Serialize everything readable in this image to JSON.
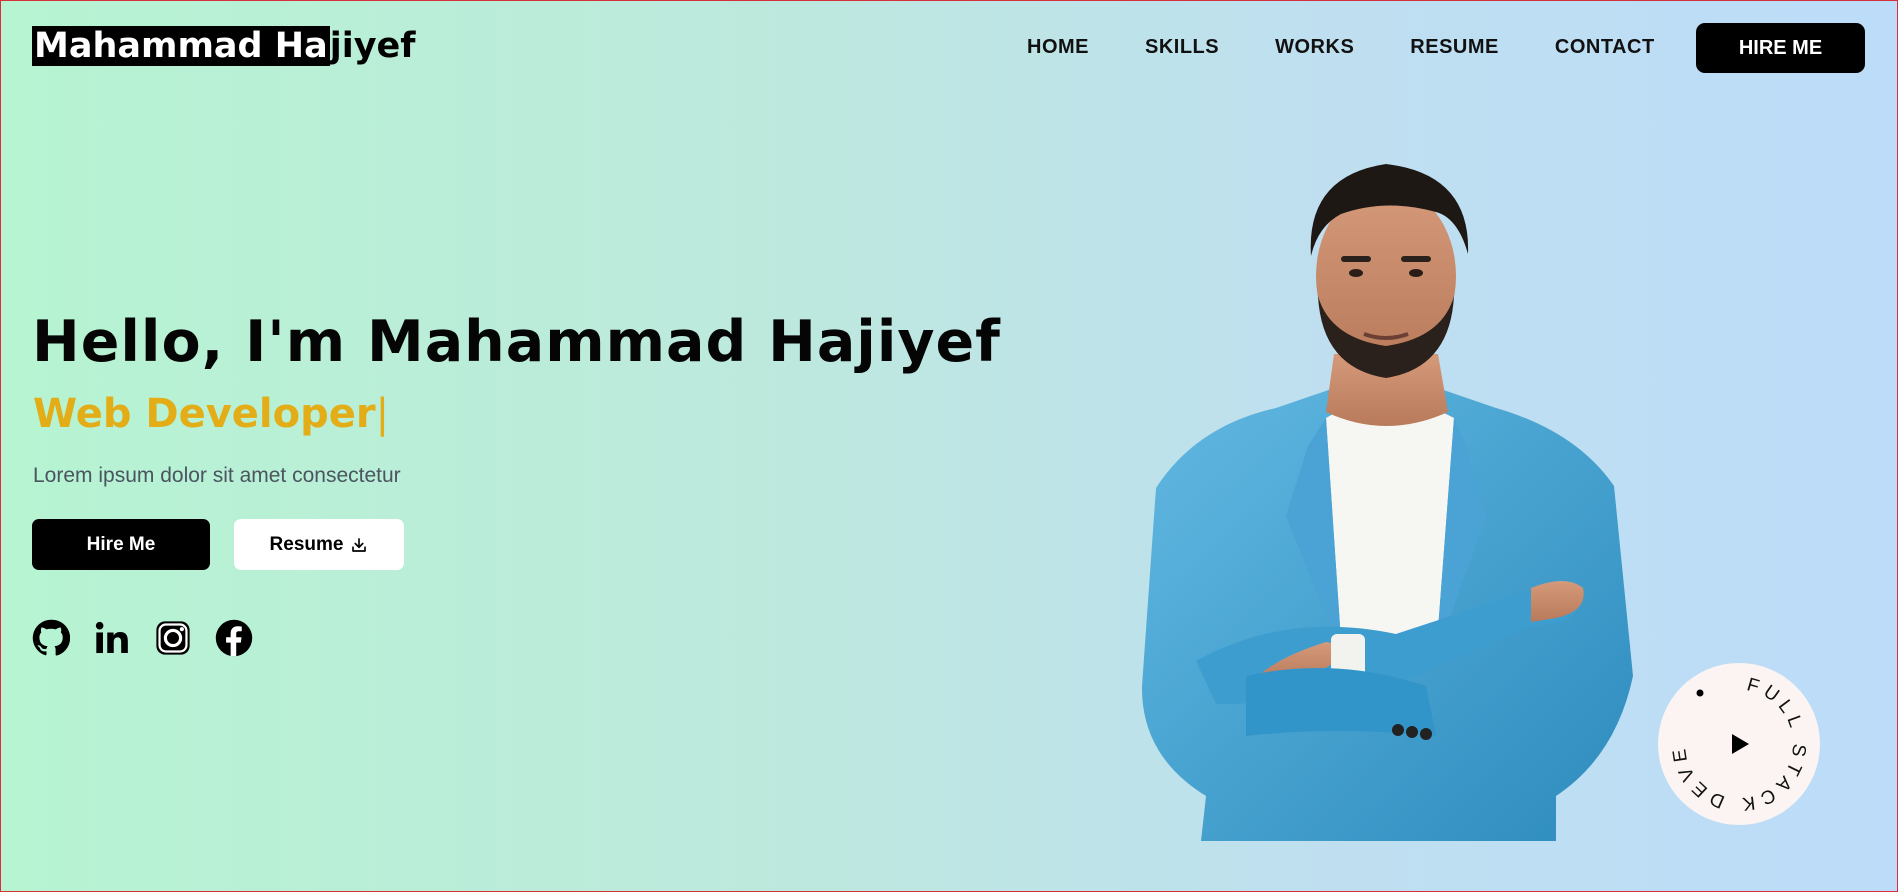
{
  "logo": {
    "highlighted": "Mahammad Ha",
    "rest": "jiyef"
  },
  "nav": {
    "items": [
      "HOME",
      "SKILLS",
      "WORKS",
      "RESUME",
      "CONTACT"
    ],
    "hire_label": "HIRE ME"
  },
  "hero": {
    "title": "Hello, I'm Mahammad Hajiyef",
    "role": "Web Developer",
    "cursor": "|",
    "description": "Lorem ipsum dolor sit amet consectetur",
    "primary_button": "Hire Me",
    "secondary_button": "Resume"
  },
  "socials": [
    "github-icon",
    "linkedin-icon",
    "instagram-icon",
    "facebook-icon"
  ],
  "badge": {
    "text": "FULL STACK DEVELOPER"
  },
  "colors": {
    "accent": "#e3ad17",
    "dark": "#000000",
    "border": "#d6303a"
  }
}
